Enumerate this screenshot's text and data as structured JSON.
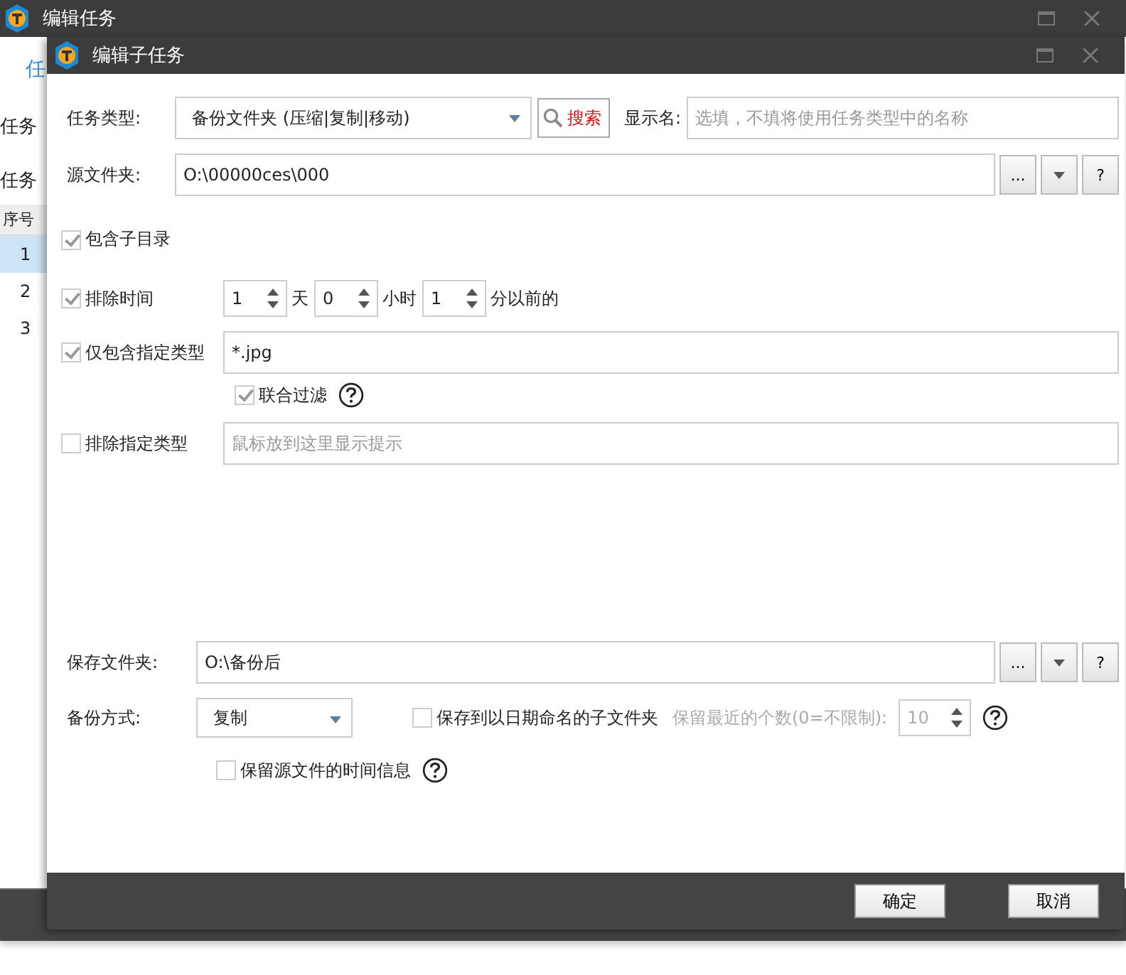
{
  "back_window": {
    "title": "编辑任务",
    "tab_label": "任",
    "field_labels": [
      "任务",
      "任务"
    ],
    "table": {
      "header": "序号",
      "rows": [
        {
          "cell": "1",
          "selected": true
        },
        {
          "cell": "2",
          "selected": false
        },
        {
          "cell": "3",
          "selected": false
        }
      ]
    }
  },
  "dialog": {
    "title": "编辑子任务",
    "task_type": {
      "label": "任务类型:",
      "value": "备份文件夹 (压缩|复制|移动)",
      "search_button": "搜索",
      "display_name_label": "显示名:",
      "display_name_placeholder": "选填，不填将使用任务类型中的名称"
    },
    "source": {
      "label": "源文件夹:",
      "value": "O:\\00000ces\\000",
      "buttons": [
        "...",
        "?"
      ]
    },
    "include_subdirs": {
      "label": "包含子目录",
      "checked": true
    },
    "exclude_time": {
      "label": "排除时间",
      "checked": true,
      "spinners": [
        {
          "value": "1",
          "unit": "天"
        },
        {
          "value": "0",
          "unit": "小时"
        },
        {
          "value": "1",
          "unit": "分以前的"
        }
      ]
    },
    "include_types": {
      "label": "仅包含指定类型",
      "checked": true,
      "value": "*.jpg"
    },
    "joint_filter": {
      "label": "联合过滤",
      "checked": true
    },
    "exclude_types": {
      "label": "排除指定类型",
      "checked": false,
      "placeholder": "鼠标放到这里显示提示"
    },
    "save_folder": {
      "label": "保存文件夹:",
      "value": "O:\\备份后",
      "buttons": [
        "...",
        "?"
      ]
    },
    "backup_mode": {
      "label": "备份方式:",
      "value": "复制"
    },
    "date_subfolder": {
      "label": "保存到以日期命名的子文件夹",
      "checked": false
    },
    "keep_recent": {
      "label": "保留最近的个数(0=不限制):",
      "value": "10",
      "disabled": true
    },
    "keep_time_info": {
      "label": "保留源文件的时间信息",
      "checked": false
    },
    "ok_button": "确定",
    "cancel_button": "取消"
  }
}
